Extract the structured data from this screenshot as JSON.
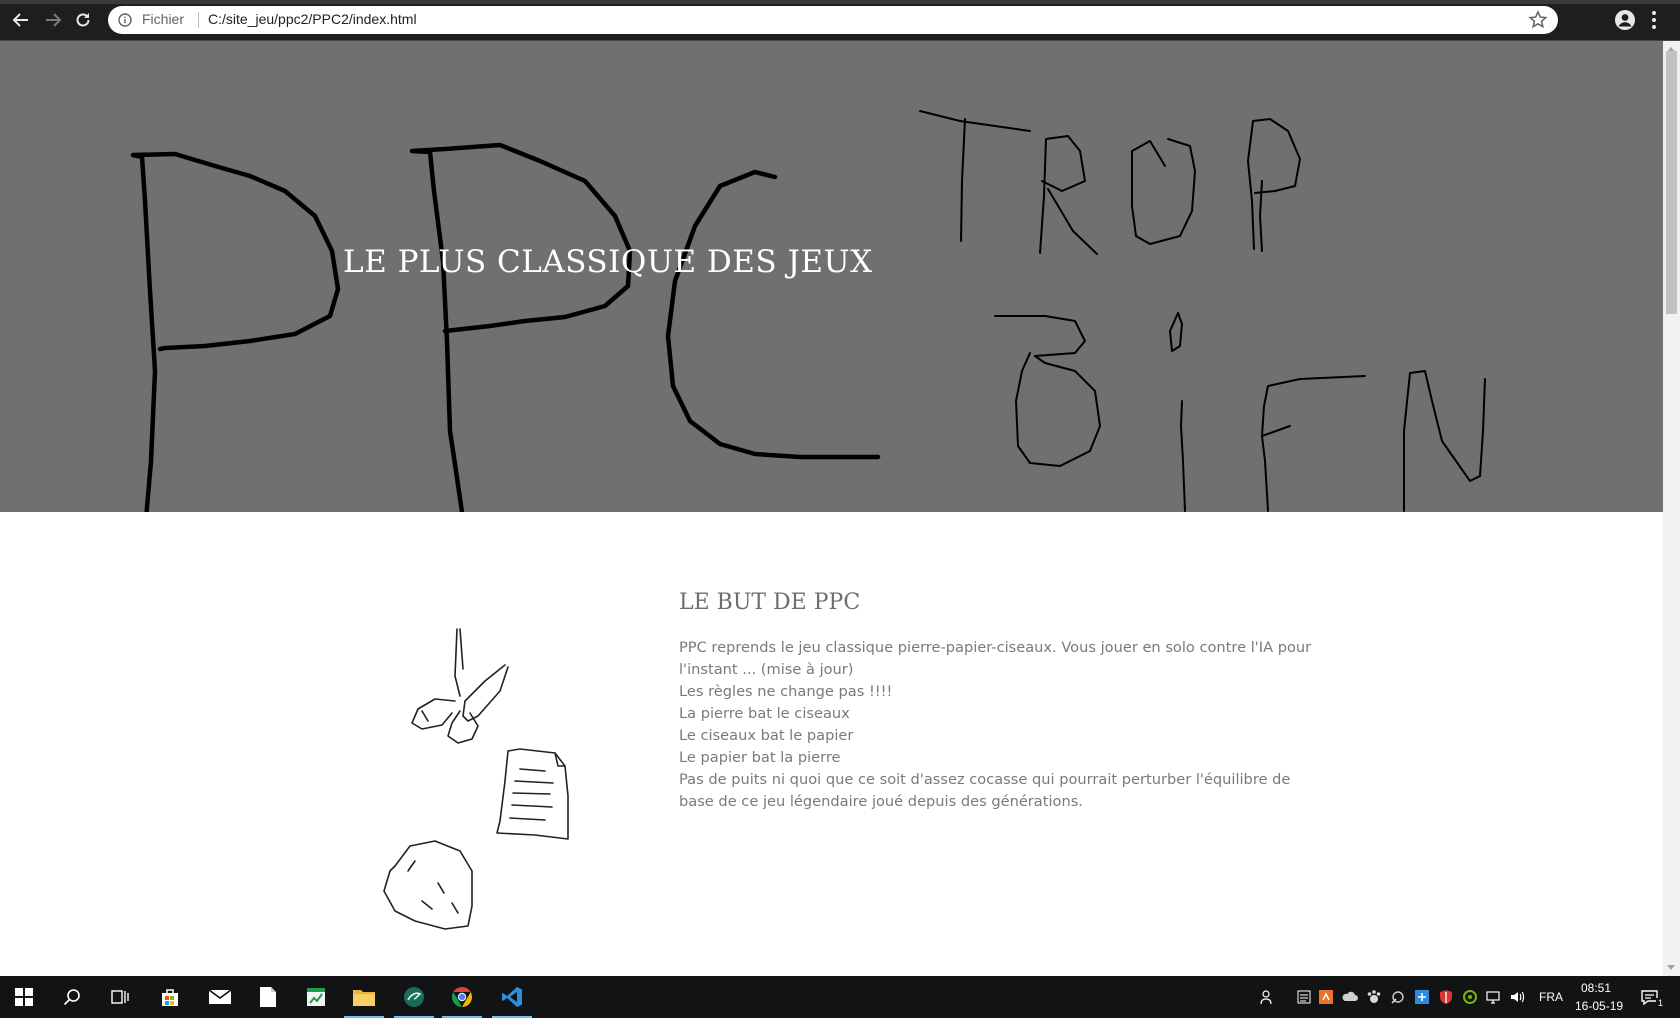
{
  "browser": {
    "back_icon": "arrow-left-icon",
    "forward_icon": "arrow-right-icon",
    "reload_icon": "reload-icon",
    "scheme_label": "Fichier",
    "url": "C:/site_jeu/ppc2/PPC2/index.html",
    "bookmark_icon": "star-icon",
    "profile_icon": "account-icon",
    "menu_icon": "kebab-icon"
  },
  "hero": {
    "title": "LE PLUS CLASSIQUE DES JEUX",
    "background": "#707070",
    "drawing_words": [
      "PPC",
      "TROP",
      "BIEN"
    ]
  },
  "main": {
    "heading": "LE BUT DE PPC",
    "paragraph_lines": [
      "PPC reprends le jeu classique pierre-papier-ciseaux. Vous jouer en solo contre l'IA pour l'instant ... (mise à jour)",
      "Les règles ne change pas !!!!",
      "La pierre bat le ciseaux",
      "Le ciseaux bat le papier",
      "Le papier bat la pierre",
      "Pas de puits ni quoi que ce soit d'assez cocasse qui pourrait perturber l'équilibre de base de ce jeu légendaire joué depuis des générations."
    ],
    "illustration_items": [
      "scissors-drawing",
      "paper-drawing",
      "rock-drawing"
    ]
  },
  "taskbar": {
    "apps": [
      "start-icon",
      "search-icon",
      "task-view-icon",
      "store-icon",
      "mail-icon",
      "file-icon",
      "spreadsheet-icon",
      "explorer-icon",
      "app-icon",
      "chrome-icon",
      "vscode-icon"
    ],
    "language": "FRA",
    "time": "08:51",
    "date": "16-05-19",
    "notification_count": "1"
  }
}
